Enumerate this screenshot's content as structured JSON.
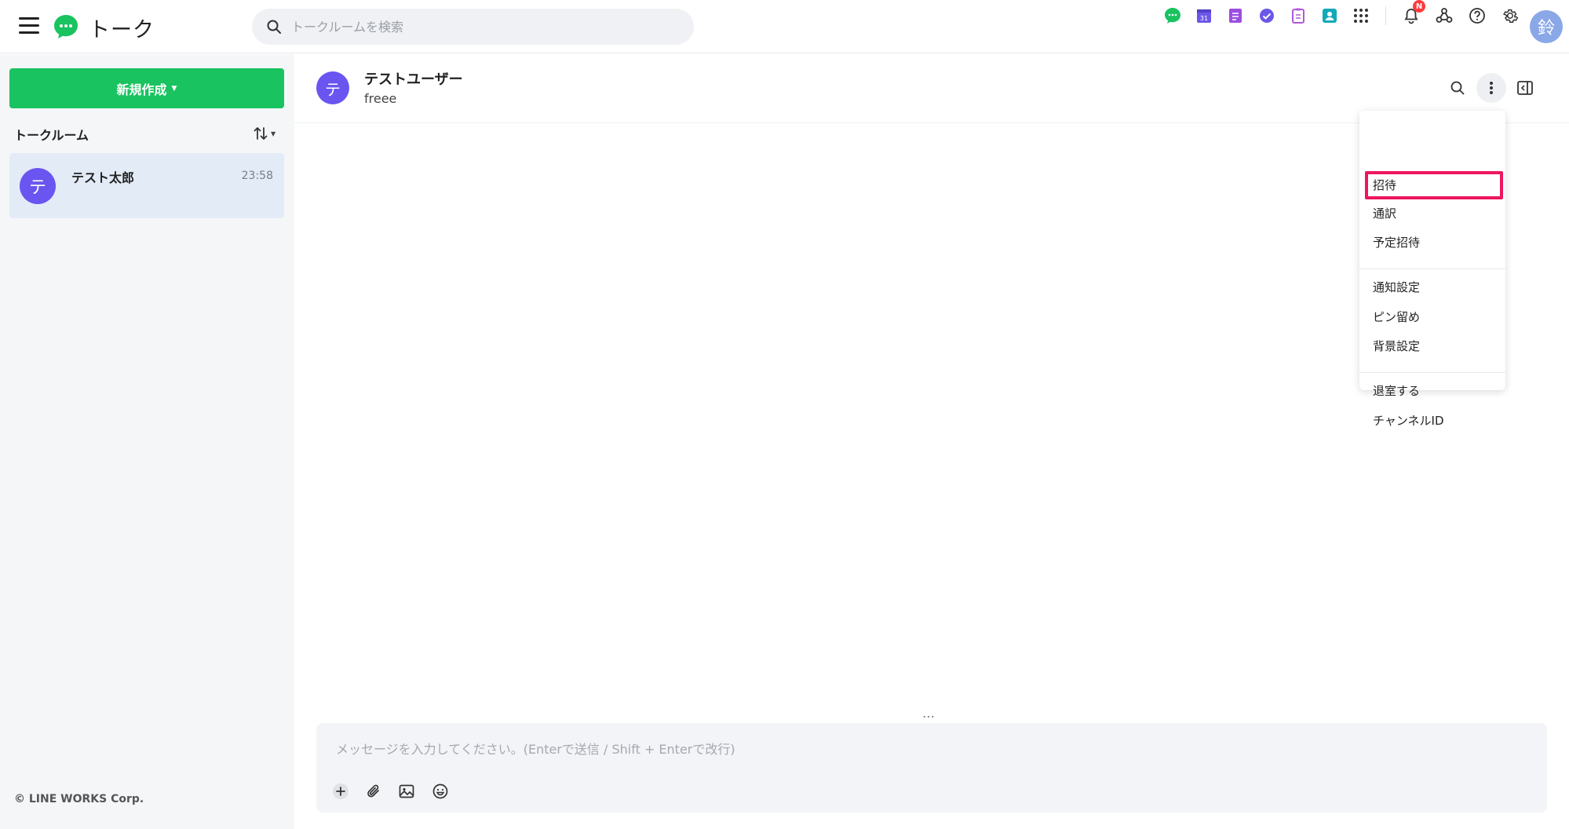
{
  "app": {
    "title": "トーク"
  },
  "search": {
    "placeholder": "トークルームを検索"
  },
  "topbar": {
    "notification_badge": "N",
    "user_avatar_initial": "鈴"
  },
  "sidebar": {
    "new_button_label": "新規作成",
    "rooms_header": "トークルーム",
    "rooms": [
      {
        "avatar_initial": "テ",
        "name": "テスト太郎",
        "time": "23:58"
      }
    ],
    "copyright": "© LINE WORKS Corp."
  },
  "chat": {
    "avatar_initial": "テ",
    "title": "テストユーザー",
    "subtitle": "freee"
  },
  "menu": {
    "items": [
      "招待",
      "通訳",
      "予定招待",
      "通知設定",
      "ピン留め",
      "背景設定",
      "退室する",
      "チャンネルID"
    ]
  },
  "composer": {
    "placeholder": "メッセージを入力してください。(Enterで送信 / Shift + Enterで改行)",
    "more": "…"
  },
  "colors": {
    "brand_green": "#19c35f",
    "avatar_purple": "#6a55f0",
    "highlight_pink": "#ee1560",
    "selected_room_bg": "#e3ebf7"
  }
}
